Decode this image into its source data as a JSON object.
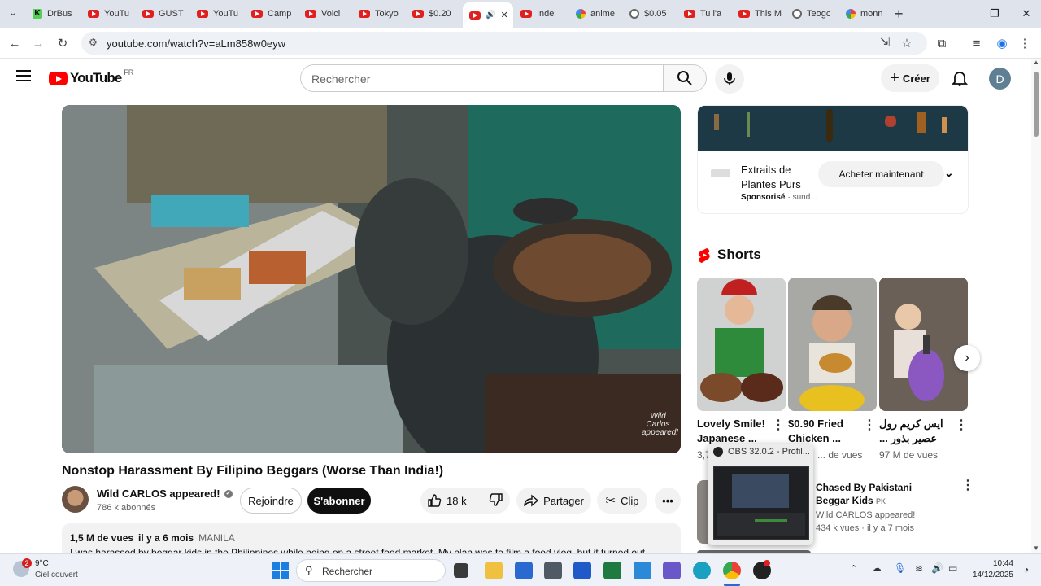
{
  "browser": {
    "tabs": [
      {
        "label": "DrBus",
        "icon": "k-icon"
      },
      {
        "label": "YouTu",
        "icon": "youtube-icon"
      },
      {
        "label": "GUST",
        "icon": "youtube-icon"
      },
      {
        "label": "YouTu",
        "icon": "youtube-icon"
      },
      {
        "label": "Camp",
        "icon": "youtube-icon"
      },
      {
        "label": "Voici",
        "icon": "youtube-icon"
      },
      {
        "label": "Tokyo",
        "icon": "youtube-icon"
      },
      {
        "label": "$0.20",
        "icon": "youtube-icon"
      },
      {
        "label": "",
        "icon": "youtube-icon"
      },
      {
        "label": "Inde",
        "icon": "youtube-icon"
      },
      {
        "label": "anime",
        "icon": "google-icon"
      },
      {
        "label": "$0.05",
        "icon": "globe-icon"
      },
      {
        "label": "Tu l'a",
        "icon": "youtube-icon"
      },
      {
        "label": "This M",
        "icon": "youtube-icon"
      },
      {
        "label": "Teogc",
        "icon": "globe-icon"
      },
      {
        "label": "monn",
        "icon": "google-icon"
      }
    ],
    "url": "youtube.com/watch?v=aLm858w0eyw"
  },
  "youtube": {
    "logo_text": "YouTube",
    "region": "FR",
    "search_placeholder": "Rechercher",
    "create_label": "Créer",
    "avatar_letter": "D"
  },
  "video": {
    "title": "Nonstop Harassment By Filipino Beggars (Worse Than India!)",
    "watermark": "Wild Carlos appeared!",
    "channel_name": "Wild CARLOS appeared!",
    "subscribers": "786 k abonnés",
    "join_label": "Rejoindre",
    "subscribe_label": "S'abonner",
    "likes": "18 k",
    "share_label": "Partager",
    "clip_label": "Clip",
    "views": "1,5 M de vues",
    "date": "il y a 6 mois",
    "location": "MANILA",
    "description": "I was harassed by beggar kids in the Philippines while being on a street food market. My plan was to film a food vlog, but it turned out"
  },
  "ad": {
    "title": "Extraits de Plantes Purs",
    "sponsored": "Sponsorisé",
    "advertiser": "· sund...",
    "cta": "Acheter maintenant"
  },
  "shorts": {
    "heading": "Shorts",
    "items": [
      {
        "title": "Lovely Smile! Japanese ...",
        "views": "3,7 ..."
      },
      {
        "title": "$0.90 Fried Chicken ...",
        "views": "... de vues"
      },
      {
        "title": "ایس کریم رول عصیر بذور ...",
        "views": "97 M de vues"
      }
    ]
  },
  "related": {
    "title": "Chased By Pakistani Beggar Kids",
    "badge": "PK",
    "channel": "Wild CARLOS appeared!",
    "meta": "434 k vues · il y a 7 mois"
  },
  "obs_popup": {
    "title": "OBS 32.0.2 - Profil..."
  },
  "taskbar": {
    "temperature": "9°C",
    "weather": "Ciel couvert",
    "notifications": "2",
    "search_placeholder": "Rechercher",
    "time": "10:44",
    "date": "14/12/2025"
  }
}
